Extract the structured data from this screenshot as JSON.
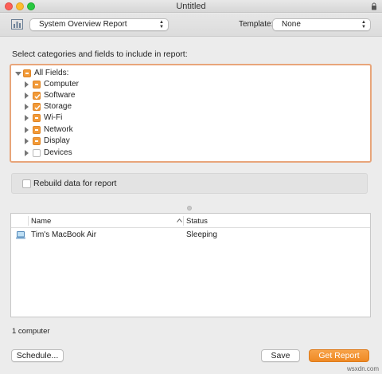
{
  "window": {
    "title": "Untitled"
  },
  "toolbar": {
    "report_type": "System Overview Report",
    "template_label": "Template:",
    "template_value": "None"
  },
  "categories": {
    "heading": "Select categories and fields to include in report:",
    "items": [
      {
        "label": "All Fields:",
        "state": "mixed",
        "disclosure": "down"
      },
      {
        "label": "Computer",
        "state": "mixed",
        "disclosure": "right"
      },
      {
        "label": "Software",
        "state": "checked",
        "disclosure": "right"
      },
      {
        "label": "Storage",
        "state": "checked",
        "disclosure": "right"
      },
      {
        "label": "Wi-Fi",
        "state": "mixed",
        "disclosure": "right"
      },
      {
        "label": "Network",
        "state": "mixed",
        "disclosure": "right"
      },
      {
        "label": "Display",
        "state": "mixed",
        "disclosure": "right"
      },
      {
        "label": "Devices",
        "state": "unchecked",
        "disclosure": "right"
      }
    ]
  },
  "rebuild": {
    "label": "Rebuild data for report",
    "checked": false
  },
  "computers": {
    "columns": {
      "name": "Name",
      "status": "Status"
    },
    "rows": [
      {
        "name": "Tim's MacBook Air",
        "status": "Sleeping"
      }
    ],
    "count_label": "1 computer"
  },
  "buttons": {
    "schedule": "Schedule...",
    "save": "Save",
    "get_report": "Get Report"
  },
  "watermark": "wsxdn.com",
  "colors": {
    "accent": "#f29a38",
    "focus_ring": "#e8a57a",
    "close": "#fc5f57",
    "minimize": "#fdbc2e",
    "maximize": "#28c840"
  }
}
